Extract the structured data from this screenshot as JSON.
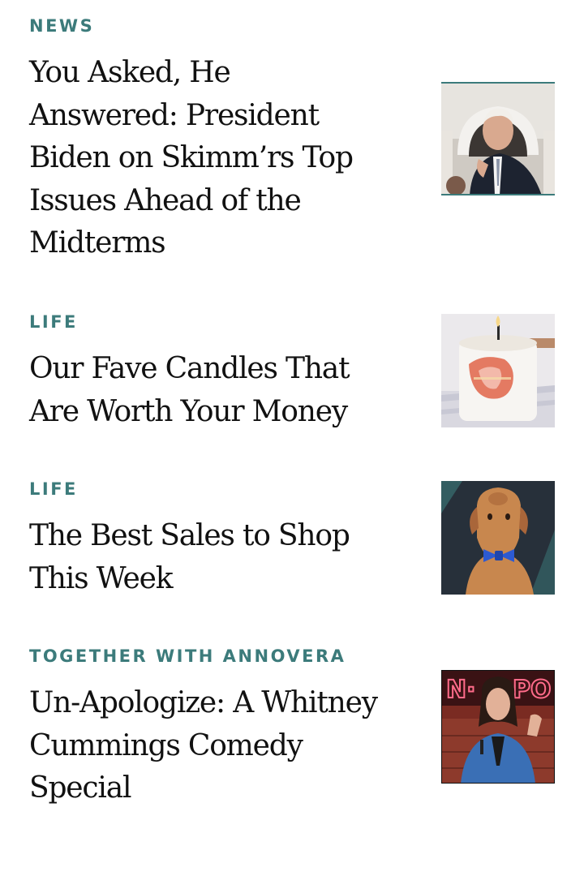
{
  "accent_color": "#3c7b7b",
  "articles": [
    {
      "category": "NEWS",
      "headline": "You Asked, He Answered: President Biden on Skimm’rs Top Issues Ahead of the Midterms",
      "thumbnail": "president-photo"
    },
    {
      "category": "LIFE",
      "headline": "Our Fave Candles That Are Worth Your Money",
      "thumbnail": "candle-photo"
    },
    {
      "category": "LIFE",
      "headline": "The Best Sales to Shop This Week",
      "thumbnail": "dog-photo"
    },
    {
      "category": "TOGETHER WITH ANNOVERA",
      "headline": "Un-Apologize: A Whitney Cummings Comedy Special",
      "thumbnail": "comedian-photo"
    }
  ]
}
